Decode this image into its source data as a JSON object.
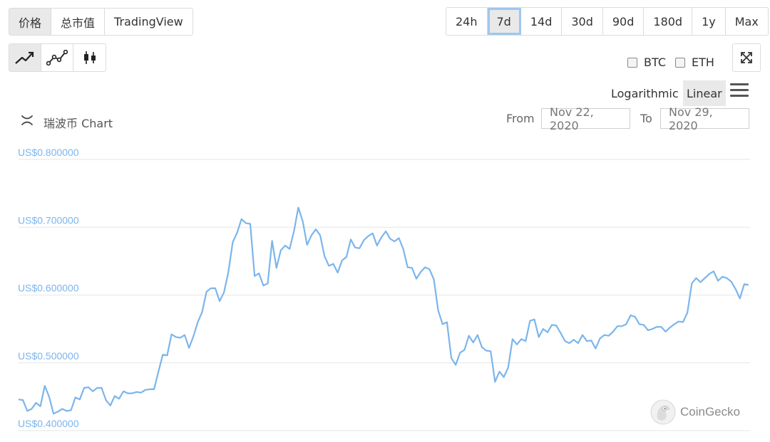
{
  "view_tabs": [
    "价格",
    "总市值",
    "TradingView"
  ],
  "chart_type_icons": [
    "line-chart-icon",
    "point-line-chart-icon",
    "candlestick-icon"
  ],
  "ranges": [
    "24h",
    "7d",
    "14d",
    "30d",
    "90d",
    "180d",
    "1y",
    "Max"
  ],
  "selected_range": "7d",
  "compare": {
    "btc": "BTC",
    "eth": "ETH"
  },
  "scale": {
    "log": "Logarithmic",
    "linear": "Linear"
  },
  "chart_title": "瑞波币 Chart",
  "range_inputs": {
    "from_label": "From",
    "from_value": "Nov 22, 2020",
    "to_label": "To",
    "to_value": "Nov 29, 2020"
  },
  "watermark": "CoinGecko",
  "colors": {
    "line": "#7cb5ec",
    "grid": "#e6e6e6",
    "selected_outline": "#9ec7f0"
  },
  "chart_data": {
    "type": "line",
    "title": "",
    "xlabel": "",
    "ylabel": "",
    "ylim": [
      0.4,
      0.8
    ],
    "yticks": [
      0.4,
      0.5,
      0.6,
      0.7,
      0.8
    ],
    "ytick_labels": [
      "US$0.400000",
      "US$0.500000",
      "US$0.600000",
      "US$0.700000",
      "US$0.800000"
    ],
    "x_start": "Nov 22, 2020",
    "x_end": "Nov 29, 2020",
    "grid": true,
    "legend": "none",
    "series": [
      {
        "values": [
          0.446,
          0.445,
          0.429,
          0.432,
          0.441,
          0.436,
          0.466,
          0.45,
          0.425,
          0.428,
          0.432,
          0.429,
          0.43,
          0.449,
          0.446,
          0.463,
          0.464,
          0.458,
          0.463,
          0.463,
          0.445,
          0.437,
          0.451,
          0.447,
          0.458,
          0.455,
          0.455,
          0.457,
          0.456,
          0.46,
          0.461,
          0.461,
          0.487,
          0.512,
          0.511,
          0.542,
          0.538,
          0.537,
          0.541,
          0.522,
          0.539,
          0.56,
          0.575,
          0.605,
          0.61,
          0.61,
          0.591,
          0.604,
          0.634,
          0.678,
          0.692,
          0.712,
          0.706,
          0.705,
          0.628,
          0.632,
          0.614,
          0.617,
          0.68,
          0.64,
          0.666,
          0.673,
          0.668,
          0.694,
          0.729,
          0.709,
          0.674,
          0.688,
          0.697,
          0.688,
          0.657,
          0.643,
          0.646,
          0.633,
          0.651,
          0.656,
          0.682,
          0.67,
          0.669,
          0.681,
          0.687,
          0.691,
          0.673,
          0.685,
          0.694,
          0.683,
          0.679,
          0.684,
          0.668,
          0.641,
          0.64,
          0.624,
          0.634,
          0.641,
          0.638,
          0.623,
          0.577,
          0.557,
          0.56,
          0.507,
          0.497,
          0.515,
          0.519,
          0.54,
          0.53,
          0.541,
          0.523,
          0.518,
          0.517,
          0.472,
          0.487,
          0.479,
          0.493,
          0.535,
          0.527,
          0.535,
          0.532,
          0.562,
          0.564,
          0.538,
          0.55,
          0.545,
          0.556,
          0.555,
          0.544,
          0.532,
          0.529,
          0.534,
          0.529,
          0.541,
          0.532,
          0.533,
          0.521,
          0.536,
          0.541,
          0.54,
          0.546,
          0.554,
          0.554,
          0.557,
          0.57,
          0.568,
          0.557,
          0.556,
          0.548,
          0.55,
          0.553,
          0.553,
          0.546,
          0.552,
          0.557,
          0.561,
          0.56,
          0.574,
          0.617,
          0.625,
          0.619,
          0.625,
          0.631,
          0.635,
          0.621,
          0.627,
          0.625,
          0.62,
          0.609,
          0.595,
          0.616,
          0.615
        ]
      }
    ]
  }
}
